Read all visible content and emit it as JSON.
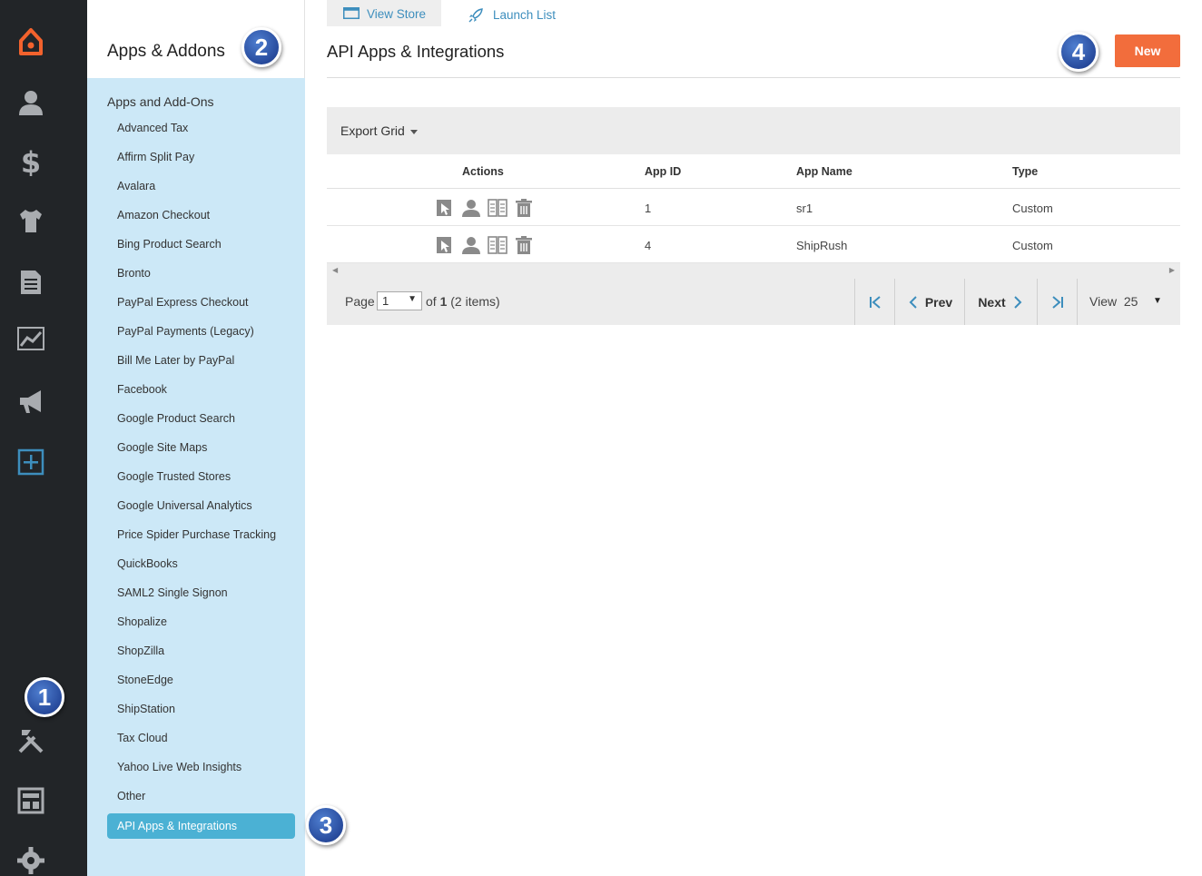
{
  "rail": {
    "icons": [
      "brand-logo-icon",
      "customers-icon",
      "dollar-icon",
      "tshirt-icon",
      "document-icon",
      "chart-icon",
      "megaphone-icon",
      "plus-box-icon",
      "tools-icon",
      "layout-icon",
      "gear-icon"
    ]
  },
  "subnav": {
    "title": "Apps & Addons",
    "section": "Apps and Add-Ons",
    "items": [
      "Advanced Tax",
      "Affirm Split Pay",
      "Avalara",
      "Amazon Checkout",
      "Bing Product Search",
      "Bronto",
      "PayPal Express Checkout",
      "PayPal Payments (Legacy)",
      "Bill Me Later by PayPal",
      "Facebook",
      "Google Product Search",
      "Google Site Maps",
      "Google Trusted Stores",
      "Google Universal Analytics",
      "Price Spider Purchase Tracking",
      "QuickBooks",
      "SAML2 Single Signon",
      "Shopalize",
      "ShopZilla",
      "StoneEdge",
      "ShipStation",
      "Tax Cloud",
      "Yahoo Live Web Insights",
      "Other",
      "API Apps & Integrations"
    ],
    "active": "API Apps & Integrations"
  },
  "badges": [
    "1",
    "2",
    "3",
    "4"
  ],
  "topbar": {
    "view_store": "View Store",
    "launch_list": "Launch List"
  },
  "page": {
    "title": "API Apps & Integrations",
    "new_label": "New"
  },
  "grid": {
    "export_label": "Export Grid",
    "columns": [
      "Actions",
      "App ID",
      "App Name",
      "Type"
    ],
    "rows": [
      {
        "app_id": "1",
        "app_name": "sr1",
        "type": "Custom"
      },
      {
        "app_id": "4",
        "app_name": "ShipRush",
        "type": "Custom"
      }
    ],
    "action_icons": [
      "select-icon",
      "user-icon",
      "book-icon",
      "trash-icon"
    ]
  },
  "pager": {
    "page_label": "Page",
    "page_value": "1",
    "of_prefix": "of",
    "total_pages": "1",
    "items_text": "(2 items)",
    "prev": "Prev",
    "next": "Next",
    "view_label": "View",
    "view_value": "25"
  },
  "colors": {
    "accent": "#f26d3c",
    "nav_bg": "#222528",
    "subnav_bg": "#cce8f7",
    "active_bg": "#4bb1d4",
    "link": "#3d8ebd"
  }
}
